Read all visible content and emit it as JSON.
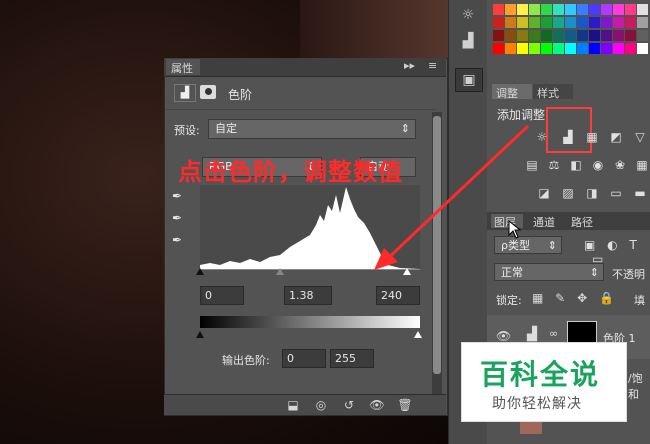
{
  "properties": {
    "tab_title": "属性",
    "panel_title": "色阶",
    "preset_label": "预设:",
    "preset_value": "自定",
    "channel_value": "RGB",
    "auto_label": "自动",
    "input_black": "0",
    "input_gamma": "1.38",
    "input_white": "240",
    "output_label": "输出色阶:",
    "output_black": "0",
    "output_white": "255"
  },
  "annotation": {
    "text": "点击色阶，调整数值",
    "color": "#ff2a2a"
  },
  "adjustments_panel": {
    "tabs": [
      "调整",
      "样式"
    ],
    "add_label": "添加调整",
    "highlight_color": "#ff3b3b"
  },
  "layers_panel": {
    "tabs": [
      "图层",
      "通道",
      "路径"
    ],
    "filter_label": "ρ类型",
    "blend_mode": "正常",
    "opacity_label": "不透明",
    "lock_label": "锁定:",
    "fill_label": "填",
    "layer_name": "色阶 1",
    "layer2_name": "/饱和"
  },
  "watermark": {
    "title": "百科全说",
    "subtitle": "助你轻松解决",
    "color": "#1aa35c"
  },
  "colors": {
    "panel_bg": "#535353",
    "dark_bg": "#3f3f3f"
  }
}
